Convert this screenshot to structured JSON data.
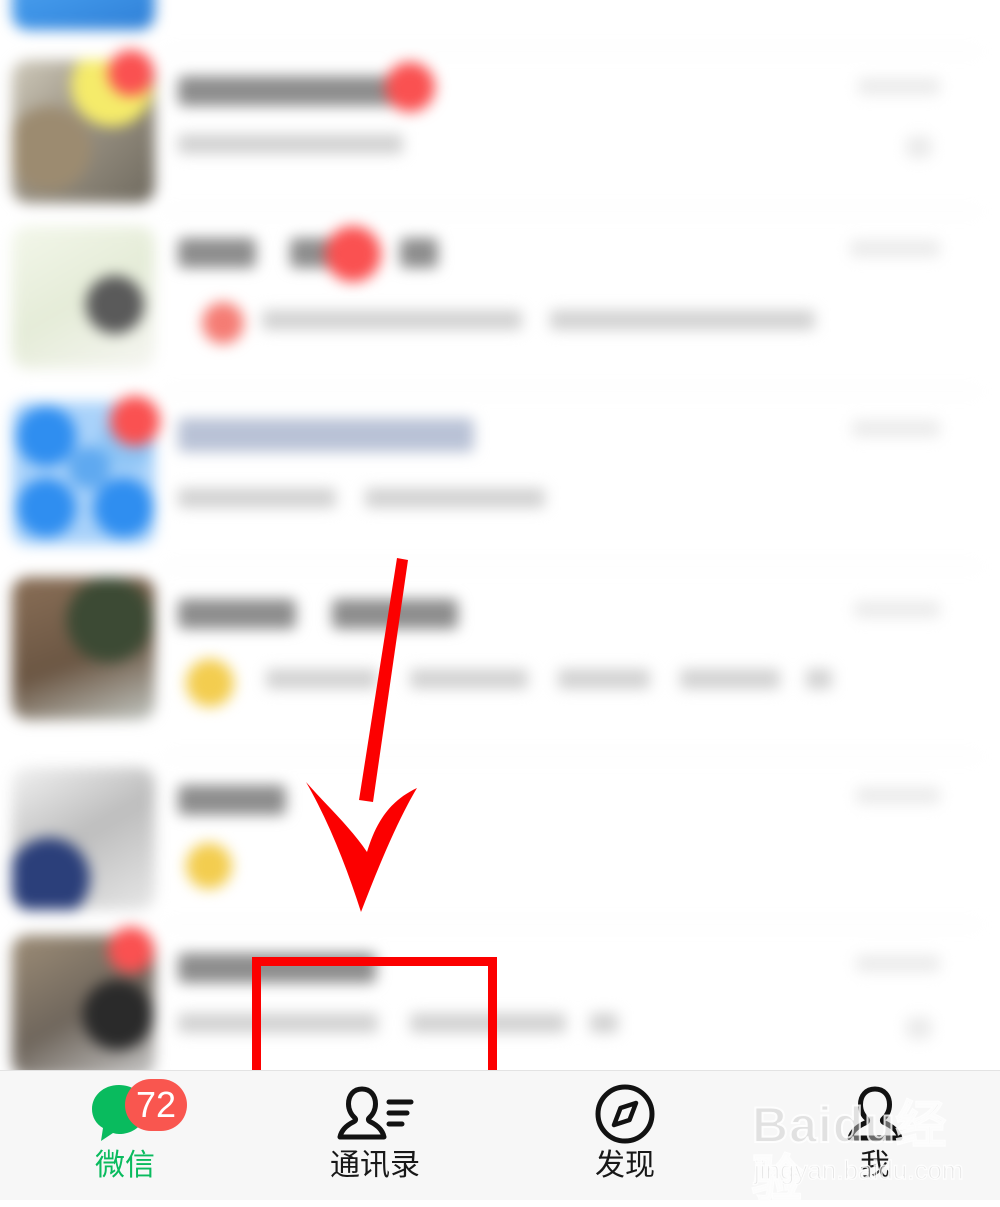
{
  "app": {
    "name": "WeChat",
    "screen": "chat-list",
    "colors": {
      "brand_green": "#09bb5e",
      "badge_red": "#f9564f",
      "annotation_red": "#fc0000",
      "tabbar_background": "#f7f7f7",
      "list_background": "#ffffff",
      "separator": "#ececec"
    }
  },
  "chat_list": {
    "note": "chat rows are blurred/obscured in the screenshot; no legible text",
    "rows": [
      {
        "index": 0,
        "avatar_type": "photo-blue",
        "avatar_color": "#4a9ae8",
        "title_text": "",
        "subtitle_text": "",
        "timestamp_text": "",
        "unread_badge": false,
        "partial_top": true
      },
      {
        "index": 1,
        "avatar_type": "photo-collage",
        "avatar_color": "#b9b2a3",
        "title_text": "",
        "subtitle_text": "",
        "timestamp_text": "",
        "unread_badge": true
      },
      {
        "index": 2,
        "avatar_type": "photo-light",
        "avatar_color": "#eef2e6",
        "title_text": "",
        "subtitle_text": "",
        "timestamp_text": "",
        "unread_badge": true
      },
      {
        "index": 3,
        "avatar_type": "group-grid-blue",
        "avatar_color": "#3f9ef5",
        "title_text": "",
        "subtitle_text": "",
        "timestamp_text": "",
        "unread_badge": true
      },
      {
        "index": 4,
        "avatar_type": "photo-dark",
        "avatar_color": "#6d6253",
        "title_text": "",
        "subtitle_text": "",
        "timestamp_text": "",
        "unread_badge": false
      },
      {
        "index": 5,
        "avatar_type": "photo-gray",
        "avatar_color": "#cfcfcf",
        "title_text": "",
        "subtitle_text": "",
        "timestamp_text": "",
        "unread_badge": false
      },
      {
        "index": 6,
        "avatar_type": "photo-brown",
        "avatar_color": "#7a6a5a",
        "title_text": "",
        "subtitle_text": "",
        "timestamp_text": "",
        "unread_badge": true
      }
    ]
  },
  "tab_bar": {
    "items": [
      {
        "key": "chats",
        "label": "微信",
        "icon": "chat-bubbles-icon",
        "active": true,
        "badge": "72"
      },
      {
        "key": "contacts",
        "label": "通讯录",
        "icon": "contacts-person-icon",
        "active": false,
        "badge": ""
      },
      {
        "key": "discover",
        "label": "发现",
        "icon": "compass-icon",
        "active": false,
        "badge": ""
      },
      {
        "key": "me",
        "label": "我",
        "icon": "person-icon",
        "active": false,
        "badge": ""
      }
    ]
  },
  "annotations": {
    "arrow": {
      "name": "red-down-arrow",
      "color": "#fc0000",
      "points_to": "contacts"
    },
    "highlight_box": {
      "name": "red-highlight-box",
      "color": "#fc0000",
      "surrounds": "通讯录"
    }
  },
  "watermark": {
    "main_text": "Baidu经验",
    "sub_text": "jingyan.baidu.com"
  }
}
